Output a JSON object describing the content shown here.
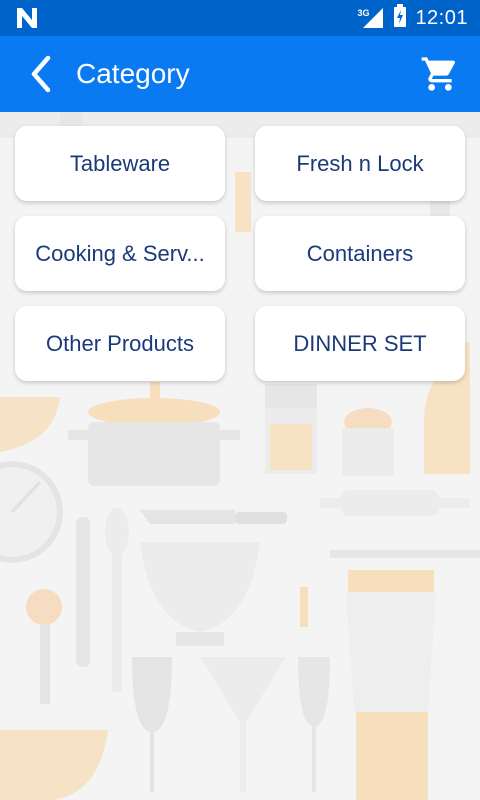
{
  "status_bar": {
    "time": "12:01",
    "network": "3G",
    "icons": [
      "notification-n-icon",
      "signal-icon",
      "battery-charging-icon"
    ]
  },
  "app_bar": {
    "title": "Category",
    "back_icon": "chevron-left-icon",
    "cart_icon": "cart-icon"
  },
  "categories": [
    {
      "label": "Tableware"
    },
    {
      "label": "Fresh n Lock"
    },
    {
      "label": "Cooking & Serv..."
    },
    {
      "label": "Containers"
    },
    {
      "label": "Other Products"
    },
    {
      "label": "DINNER SET"
    }
  ],
  "colors": {
    "status_bar": "#0063c9",
    "app_bar": "#0a7af2",
    "card_text": "#1a3a7a",
    "background": "#f4f4f4"
  }
}
